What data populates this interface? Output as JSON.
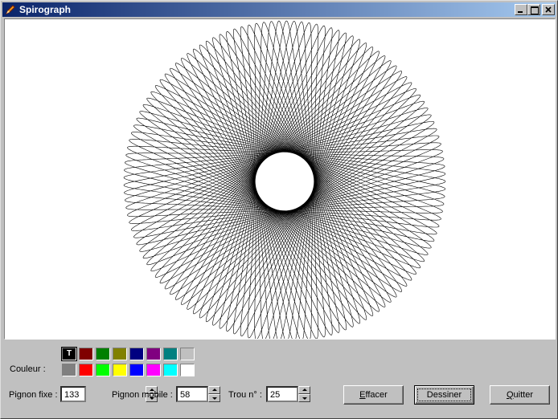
{
  "window": {
    "title": "Spirograph"
  },
  "colors": {
    "label": "Couleur :",
    "row1": [
      "#000000",
      "#800000",
      "#008000",
      "#808000",
      "#000080",
      "#800080",
      "#008080",
      "#c0c0c0"
    ],
    "row2": [
      "#808080",
      "#ff0000",
      "#00ff00",
      "#ffff00",
      "#0000ff",
      "#ff00ff",
      "#00ffff",
      "#ffffff"
    ],
    "selected_mark": "T"
  },
  "controls": {
    "pignon_fixe_label": "Pignon fixe :",
    "pignon_fixe_value": "133",
    "pignon_mobile_label": "Pignon mobile :",
    "pignon_mobile_value": "58",
    "trou_label": "Trou n° :",
    "trou_value": "25"
  },
  "buttons": {
    "effacer_first": "E",
    "effacer_rest": "ffacer",
    "dessiner": "Dessiner",
    "quitter_first": "Q",
    "quitter_rest": "uitter"
  }
}
